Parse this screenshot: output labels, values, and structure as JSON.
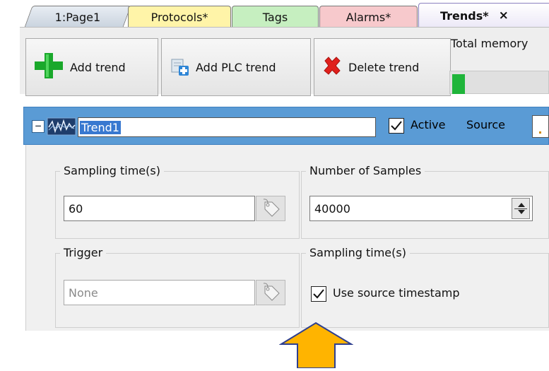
{
  "tabs": [
    {
      "label": "1:Page1"
    },
    {
      "label": "Protocols*"
    },
    {
      "label": "Tags"
    },
    {
      "label": "Alarms*"
    },
    {
      "label": "Trends*",
      "close": "×"
    }
  ],
  "toolbar": {
    "add_trend": "Add trend",
    "add_plc_trend": "Add PLC trend",
    "delete_trend": "Delete trend",
    "memory_label": "Total memory",
    "memory_fraction": 0.13
  },
  "trend": {
    "name": "Trend1",
    "active_label": "Active",
    "active_checked": true,
    "source_label": "Source"
  },
  "groups": {
    "sampling_time_title": "Sampling time(s)",
    "sampling_time_value": "60",
    "num_samples_title": "Number of Samples",
    "num_samples_value": "40000",
    "trigger_title": "Trigger",
    "trigger_placeholder": "None",
    "sampling_time2_title": "Sampling time(s)",
    "use_source_timestamp_label": "Use source timestamp",
    "use_source_timestamp_checked": true
  },
  "icons": {
    "add": "plus-icon",
    "add_plc": "plc-add-icon",
    "delete": "red-x-icon",
    "trend": "trend-wave-icon",
    "tag": "tag-icon",
    "arrow": "pointer-arrow-up"
  },
  "colors": {
    "header_blue": "#5a9bd5",
    "arrow_orange": "#ffb400",
    "memory_green": "#1fb53a"
  }
}
